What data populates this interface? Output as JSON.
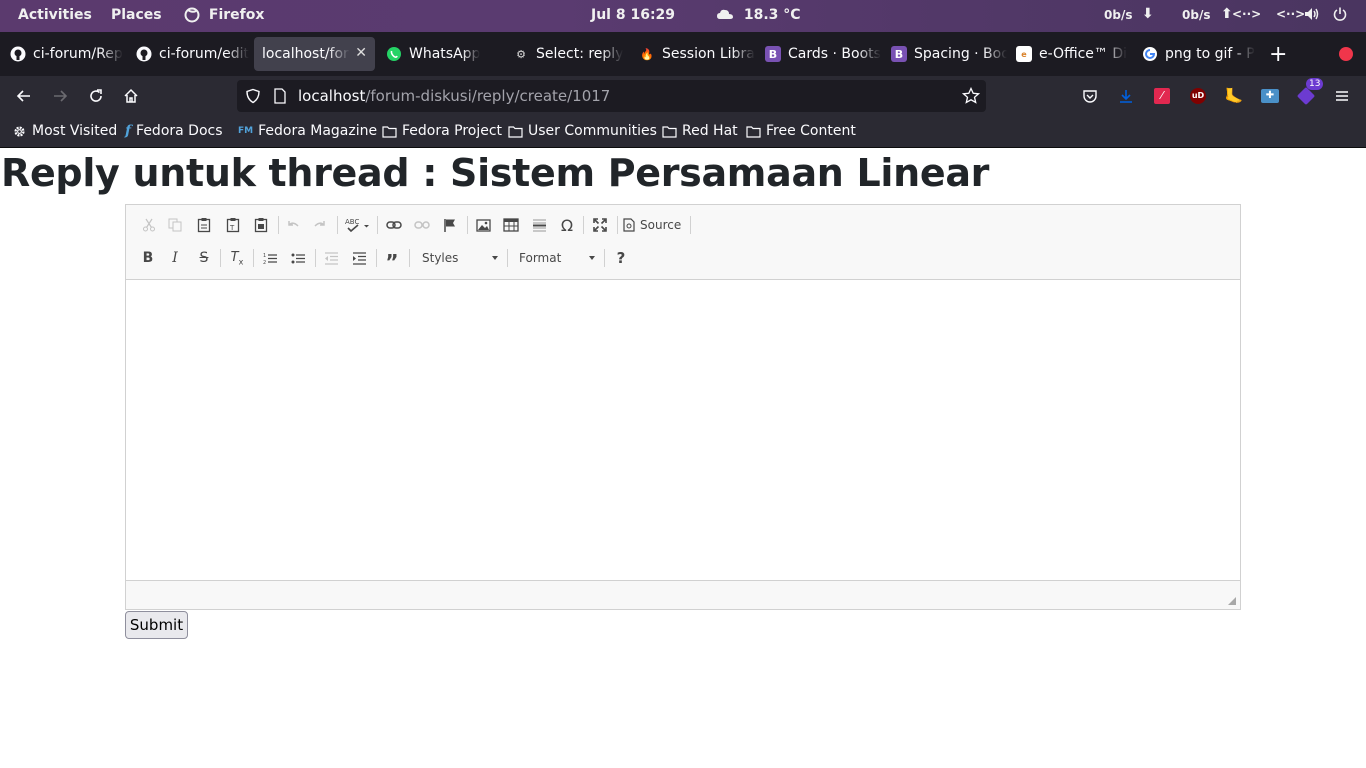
{
  "topbar": {
    "activities": "Activities",
    "places": "Places",
    "app": "Firefox",
    "clock": "Jul 8  16:29",
    "weather": "18.3 °C",
    "net_down": "0b/s",
    "net_up": "0b/s"
  },
  "tabs": [
    {
      "title": "ci-forum/Rep",
      "icon": "github-icon"
    },
    {
      "title": "ci-forum/edit",
      "icon": "github-icon"
    },
    {
      "title": "localhost/forum",
      "icon": "none",
      "active": true
    },
    {
      "title": "WhatsApp",
      "icon": "whatsapp-icon"
    },
    {
      "title": "Select: reply",
      "icon": "select-icon"
    },
    {
      "title": "Session Libra",
      "icon": "codeigniter-icon"
    },
    {
      "title": "Cards · Boots",
      "icon": "bootstrap-icon"
    },
    {
      "title": "Spacing · Boo",
      "icon": "bootstrap-icon"
    },
    {
      "title": "e-Office™ Di",
      "icon": "eoffice-icon"
    },
    {
      "title": "png to gif - P",
      "icon": "google-icon"
    }
  ],
  "navbar": {
    "url_host": "localhost",
    "url_path": "/forum-diskusi/reply/create/1017",
    "extension_badge": "13"
  },
  "bookmarks": [
    {
      "label": "Most Visited",
      "icon": "gear-icon"
    },
    {
      "label": "Fedora Docs",
      "icon": "fedora-icon"
    },
    {
      "label": "Fedora Magazine",
      "icon": "fm-icon"
    },
    {
      "label": "Fedora Project",
      "icon": "folder-icon"
    },
    {
      "label": "User Communities",
      "icon": "folder-icon"
    },
    {
      "label": "Red Hat",
      "icon": "folder-icon"
    },
    {
      "label": "Free Content",
      "icon": "folder-icon"
    }
  ],
  "page": {
    "title": "Reply untuk thread : Sistem Persamaan Linear",
    "submit_label": "Submit"
  },
  "editor": {
    "source_label": "Source",
    "styles_label": "Styles",
    "format_label": "Format",
    "help_label": "?",
    "content": ""
  }
}
